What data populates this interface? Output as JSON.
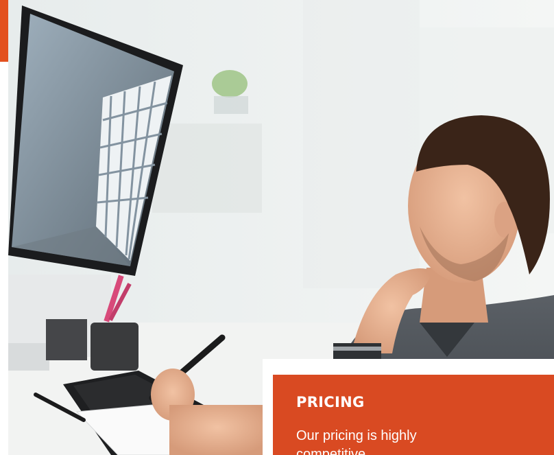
{
  "image": {
    "subject": "man-at-desk-with-monitor-and-pen-tablet"
  },
  "colors": {
    "accent": "#e3511f",
    "card_background": "#d94a22",
    "card_text": "#ffffff"
  },
  "pricing_card": {
    "title": "PRICING",
    "text": "Our pricing is highly competitive"
  }
}
